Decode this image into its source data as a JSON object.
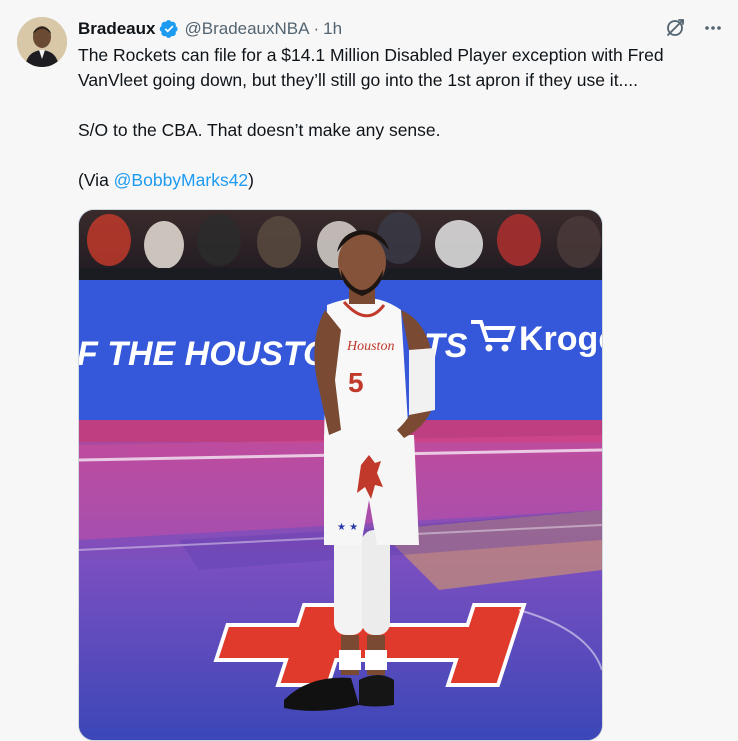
{
  "author": {
    "display_name": "Bradeaux",
    "handle": "@BradeauxNBA",
    "time": "1h",
    "verified": true
  },
  "tweet": {
    "line1": "The Rockets can file for a  $14.1 Million Disabled Player exception with Fred VanVleet going down, but they’ll still go into the 1st apron if they use it....",
    "line2": "S/O to the CBA. That doesn’t make any sense.",
    "via_prefix": "(Via ",
    "via_mention": "@BobbyMarks42",
    "via_suffix": ")"
  },
  "media": {
    "arena_banner": "F THE HOUSTON",
    "arena_banner_right": "TS",
    "sponsor": "Kroge",
    "jersey_number": "5",
    "jersey_script": "Houston",
    "court_logo": "H"
  },
  "icons": {
    "verified": "verified-badge-icon",
    "grok": "grok-icon",
    "more": "more-icon"
  },
  "colors": {
    "link": "#1d9bf0",
    "secondary_text": "#536471",
    "verified": "#1d9bf0"
  }
}
